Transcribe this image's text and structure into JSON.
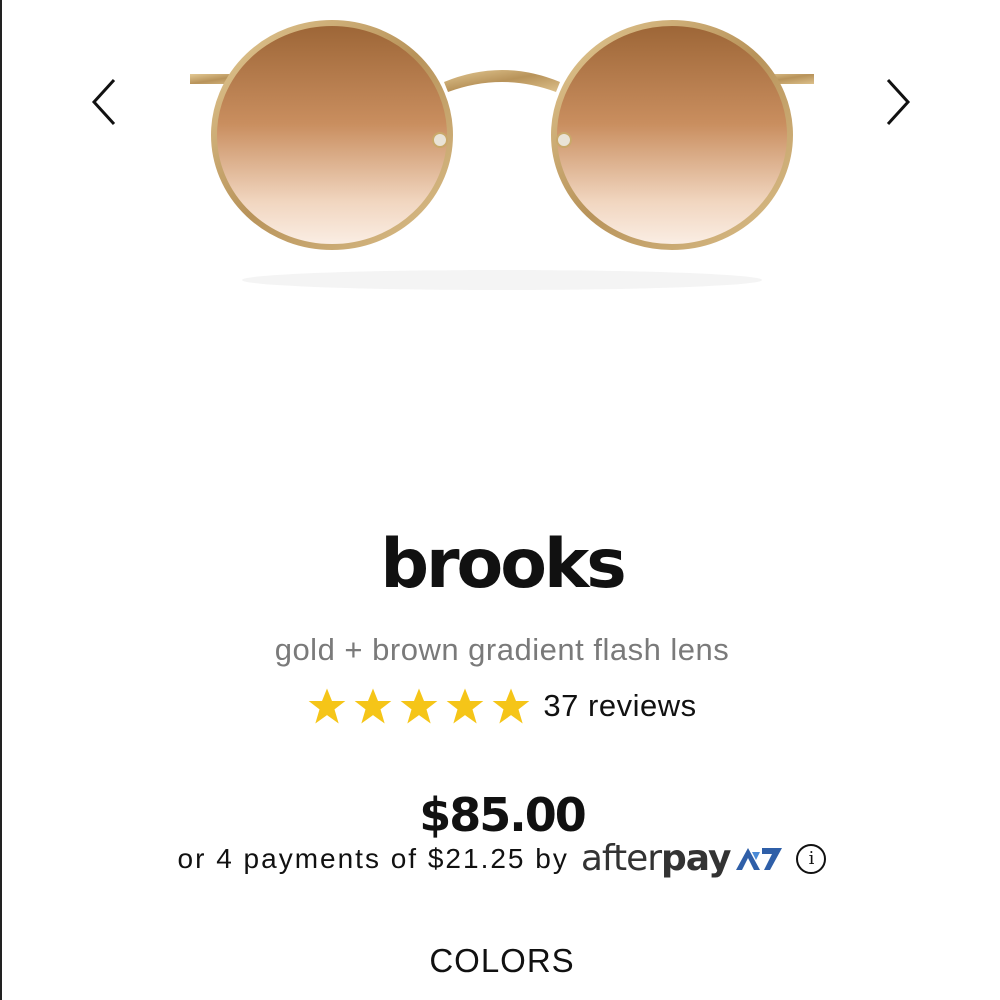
{
  "product": {
    "name": "brooks",
    "variant": "gold + brown gradient flash lens",
    "rating": 5,
    "reviews_label": "37 reviews",
    "price": "$85.00",
    "installments_text": "or 4 payments of $21.25 by",
    "afterpay_brand_light": "after",
    "afterpay_brand_bold": "pay",
    "info_symbol": "i"
  },
  "sections": {
    "colors_heading": "COLORS"
  },
  "icons": {
    "prev": "chevron-left-icon",
    "next": "chevron-right-icon",
    "star": "star-icon",
    "info": "info-icon"
  },
  "colors": {
    "star": "#F5C518",
    "afterpay_mark": "#2f5fa8",
    "frame_gold": "#c9a86a",
    "lens_top": "#a0683c",
    "lens_bottom": "#fbeee4"
  }
}
